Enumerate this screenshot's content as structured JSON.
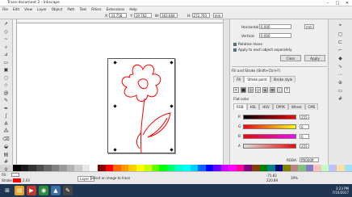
{
  "window": {
    "title": "Trace document 2 - Inkscape"
  },
  "menu": [
    "File",
    "Edit",
    "View",
    "Layer",
    "Object",
    "Path",
    "Text",
    "Filters",
    "Extensions",
    "Help"
  ],
  "toolctl": {
    "x_label": "X:",
    "x": "33.758",
    "y_label": "Y:",
    "y": "19.762",
    "w_label": "W:",
    "w": "183.684",
    "h_label": "H:",
    "h": "272.793",
    "unit": "mm"
  },
  "transform": {
    "horizontal_label": "Horizontal",
    "horizontal": "0.000",
    "vertical_label": "Vertical",
    "vertical": "0.000",
    "unit": "mm",
    "relative_move_label": "Relative move",
    "apply_separately_label": "Apply to each object separately",
    "clear_label": "Clear",
    "apply_label": "Apply"
  },
  "fill_stroke": {
    "title": "Fill and Stroke (Shift+Ctrl+F)",
    "tabs": [
      "Fill",
      "Stroke paint",
      "Stroke style"
    ],
    "flat_color_label": "Flat color",
    "modes": [
      "RGB",
      "HSL",
      "HSV",
      "CMYK",
      "Wheel",
      "CMS"
    ],
    "channels": [
      {
        "label": "R",
        "value": "255"
      },
      {
        "label": "G",
        "value": "0"
      },
      {
        "label": "B",
        "value": "0"
      },
      {
        "label": "A",
        "value": "255"
      }
    ],
    "rgba_label": "RGBA:",
    "rgba": "ff0000ff"
  },
  "status": {
    "fill_label": "Fill:",
    "stroke_label": "Stroke:",
    "stroke_width": "2.03",
    "layer": "Layer 1",
    "message": "Select an image to trace",
    "x": "-71.82",
    "y": "220.89",
    "zoom": "39%"
  },
  "taskbar": {
    "time": "3:23 PM",
    "date": "7/10/2017"
  },
  "colors": {
    "selection_stroke": "#ff0000",
    "accent": "#1f3552"
  },
  "icons": [
    "selector-icon",
    "node-icon",
    "tweak-icon",
    "zoom-icon",
    "measure-icon",
    "rect-icon",
    "3dbox-icon",
    "ellipse-icon",
    "star-icon",
    "spiral-icon",
    "pencil-icon",
    "pen-icon",
    "calligraphy-icon",
    "text-icon",
    "spray-icon",
    "eraser-icon",
    "bucket-icon",
    "gradient-icon",
    "mesh-icon",
    "dropper-icon",
    "connector-icon"
  ]
}
